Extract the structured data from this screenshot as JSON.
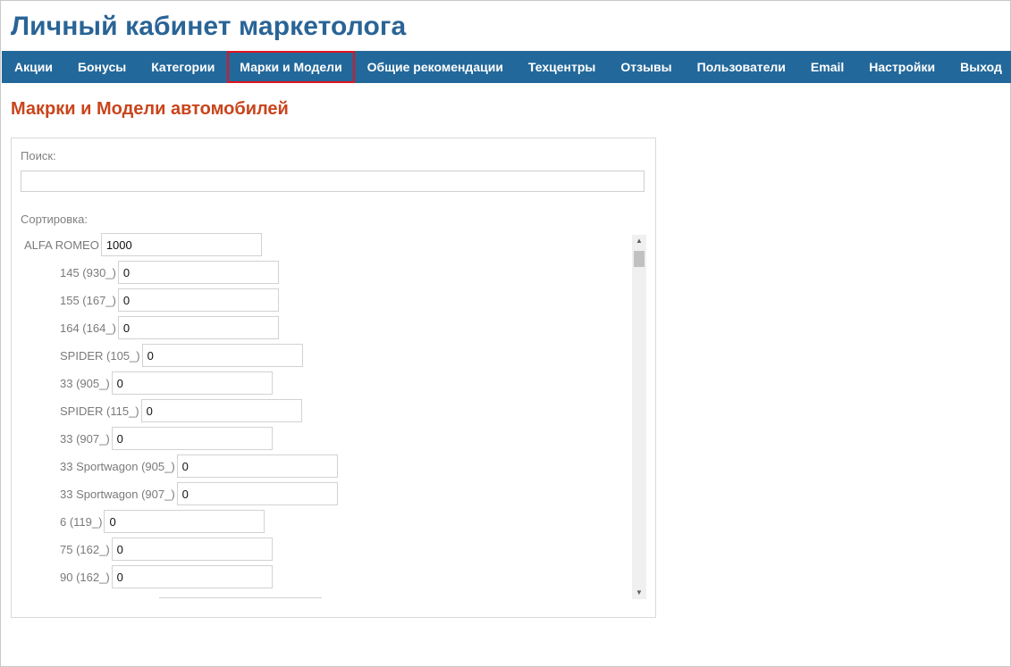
{
  "app": {
    "title": "Личный кабинет маркетолога"
  },
  "nav": {
    "items": [
      {
        "label": "Акции"
      },
      {
        "label": "Бонусы"
      },
      {
        "label": "Категории"
      },
      {
        "label": "Марки и Модели",
        "active": true
      },
      {
        "label": "Общие рекомендации"
      },
      {
        "label": "Техцентры"
      },
      {
        "label": "Отзывы"
      },
      {
        "label": "Пользователи"
      },
      {
        "label": "Email"
      },
      {
        "label": "Настройки"
      },
      {
        "label": "Выход"
      }
    ],
    "highlight_color": "#e0141e",
    "background_color": "#23689a"
  },
  "page": {
    "heading": "Макрки и Модели автомобилей",
    "heading_color": "#c8451c"
  },
  "search": {
    "label": "Поиск:",
    "value": ""
  },
  "sort": {
    "label": "Сортировка:"
  },
  "brands": [
    {
      "name": "ALFA ROMEO",
      "value": "1000"
    }
  ],
  "models": [
    {
      "name": "145 (930_)",
      "value": "0"
    },
    {
      "name": "155 (167_)",
      "value": "0"
    },
    {
      "name": "164 (164_)",
      "value": "0"
    },
    {
      "name": "SPIDER (105_)",
      "value": "0"
    },
    {
      "name": "33 (905_)",
      "value": "0"
    },
    {
      "name": "SPIDER (115_)",
      "value": "0"
    },
    {
      "name": "33 (907_)",
      "value": "0"
    },
    {
      "name": "33 Sportwagon (905_)",
      "value": "0"
    },
    {
      "name": "33 Sportwagon (907_)",
      "value": "0"
    },
    {
      "name": "6 (119_)",
      "value": "0"
    },
    {
      "name": "75 (162_)",
      "value": "0"
    },
    {
      "name": "90 (162_)",
      "value": "0"
    }
  ],
  "icons": {
    "scroll_up": "▲",
    "scroll_down": "▼"
  }
}
